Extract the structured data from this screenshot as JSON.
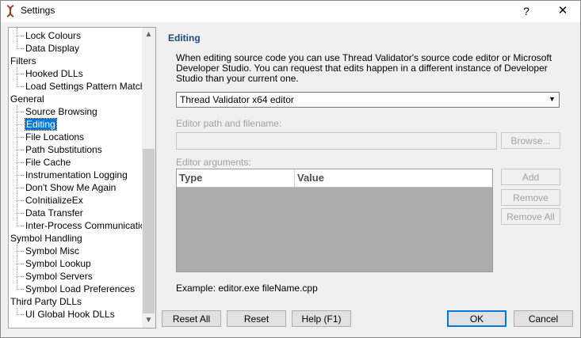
{
  "window": {
    "title": "Settings",
    "help_glyph": "?",
    "close_glyph": "✕"
  },
  "tree": {
    "items": [
      {
        "label": "Lock Colours",
        "level": 1
      },
      {
        "label": "Data Display",
        "level": 1
      },
      {
        "label": "Filters",
        "level": 0
      },
      {
        "label": "Hooked DLLs",
        "level": 1
      },
      {
        "label": "Load Settings Pattern Match",
        "level": 1
      },
      {
        "label": "General",
        "level": 0
      },
      {
        "label": "Source Browsing",
        "level": 1
      },
      {
        "label": "Editing",
        "level": 1,
        "selected": true
      },
      {
        "label": "File Locations",
        "level": 1
      },
      {
        "label": "Path Substitutions",
        "level": 1
      },
      {
        "label": "File Cache",
        "level": 1
      },
      {
        "label": "Instrumentation Logging",
        "level": 1
      },
      {
        "label": "Don't Show Me Again",
        "level": 1
      },
      {
        "label": "CoInitializeEx",
        "level": 1
      },
      {
        "label": "Data Transfer",
        "level": 1
      },
      {
        "label": "Inter-Process Communication",
        "level": 1
      },
      {
        "label": "Symbol Handling",
        "level": 0
      },
      {
        "label": "Symbol Misc",
        "level": 1
      },
      {
        "label": "Symbol Lookup",
        "level": 1
      },
      {
        "label": "Symbol Servers",
        "level": 1
      },
      {
        "label": "Symbol Load Preferences",
        "level": 1
      },
      {
        "label": "Third Party DLLs",
        "level": 0
      },
      {
        "label": "UI Global Hook DLLs",
        "level": 1
      }
    ]
  },
  "editing": {
    "title": "Editing",
    "description": "When editing source code you can use Thread Validator's source code editor or Microsoft Developer Studio. You can request that edits happen in a different instance of Developer Studio than your current one.",
    "editor_select": "Thread Validator x64 editor",
    "path_label": "Editor path and filename:",
    "path_value": "",
    "browse_label": "Browse...",
    "args_label": "Editor arguments:",
    "columns": [
      "Type",
      "Value"
    ],
    "add_label": "Add",
    "remove_label": "Remove",
    "remove_all_label": "Remove All",
    "example": "Example: editor.exe  fileName.cpp"
  },
  "footer": {
    "reset_all": "Reset All",
    "reset": "Reset",
    "help": "Help (F1)",
    "ok": "OK",
    "cancel": "Cancel"
  },
  "colors": {
    "selection": "#0078d7",
    "section_title": "#1c4a7a",
    "grid_background": "#ababab"
  }
}
